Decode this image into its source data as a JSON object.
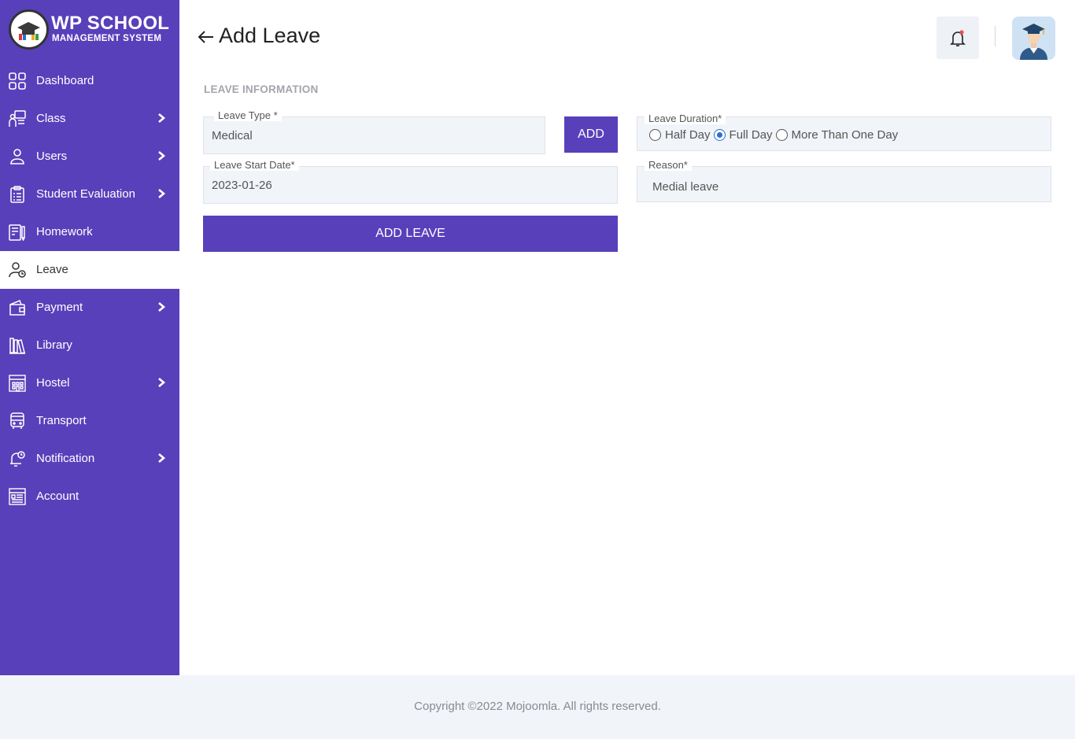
{
  "brand": {
    "title": "WP SCHOOL",
    "subtitle": "MANAGEMENT SYSTEM"
  },
  "sidebar": {
    "items": [
      {
        "label": "Dashboard",
        "icon": "grid-icon",
        "has_submenu": false,
        "active": false
      },
      {
        "label": "Class",
        "icon": "class-icon",
        "has_submenu": true,
        "active": false
      },
      {
        "label": "Users",
        "icon": "user-icon",
        "has_submenu": true,
        "active": false
      },
      {
        "label": "Student Evaluation",
        "icon": "clipboard-icon",
        "has_submenu": true,
        "active": false
      },
      {
        "label": "Homework",
        "icon": "homework-icon",
        "has_submenu": false,
        "active": false
      },
      {
        "label": "Leave",
        "icon": "leave-icon",
        "has_submenu": false,
        "active": true
      },
      {
        "label": "Payment",
        "icon": "wallet-icon",
        "has_submenu": true,
        "active": false
      },
      {
        "label": "Library",
        "icon": "library-icon",
        "has_submenu": false,
        "active": false
      },
      {
        "label": "Hostel",
        "icon": "hostel-icon",
        "has_submenu": true,
        "active": false
      },
      {
        "label": "Transport",
        "icon": "bus-icon",
        "has_submenu": false,
        "active": false
      },
      {
        "label": "Notification",
        "icon": "notification-icon",
        "has_submenu": true,
        "active": false
      },
      {
        "label": "Account",
        "icon": "account-icon",
        "has_submenu": false,
        "active": false
      }
    ]
  },
  "header": {
    "title": "Add Leave",
    "notification_dot": true
  },
  "form": {
    "section_title": "LEAVE INFORMATION",
    "leave_type": {
      "label": "Leave Type *",
      "value": "Medical"
    },
    "add_button": "ADD",
    "leave_duration": {
      "label": "Leave Duration*",
      "options": [
        "Half Day",
        "Full Day",
        "More Than One Day"
      ],
      "selected": "Full Day"
    },
    "leave_start_date": {
      "label": "Leave Start Date*",
      "value": "2023-01-26"
    },
    "reason": {
      "label": "Reason*",
      "value": "Medial leave"
    },
    "submit_button": "ADD LEAVE"
  },
  "footer": {
    "copyright": "Copyright ©2022 Mojoomla. All rights reserved."
  },
  "colors": {
    "primary": "#5840bb",
    "field_bg": "#f1f4f8",
    "radio_accent": "#2a6fd1",
    "notification_dot": "#e94f4f"
  }
}
